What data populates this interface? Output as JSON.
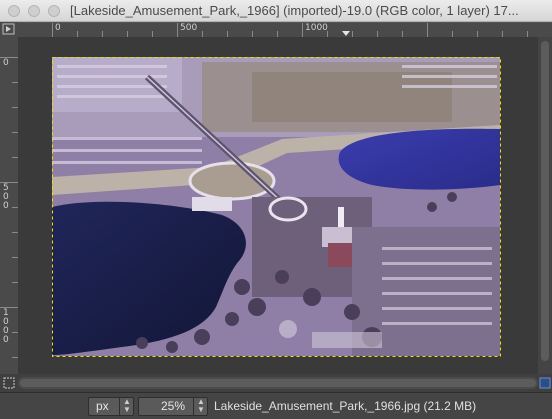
{
  "window": {
    "title": "[Lakeside_Amusement_Park,_1966] (imported)-19.0 (RGB color, 1 layer) 17..."
  },
  "rulers": {
    "horizontal_labels": [
      "0",
      "500",
      "1000"
    ],
    "vertical_labels": [
      "0",
      "500",
      "1000"
    ]
  },
  "status": {
    "unit": "px",
    "zoom": "25%",
    "file_info": "Lakeside_Amusement_Park,_1966.jpg (21.2 MB)"
  },
  "icons": {
    "menu": "menu-triangle-icon",
    "navigate": "navigate-icon",
    "quickmask": "quick-mask-icon",
    "zoom_fit": "zoom-fit-icon"
  }
}
